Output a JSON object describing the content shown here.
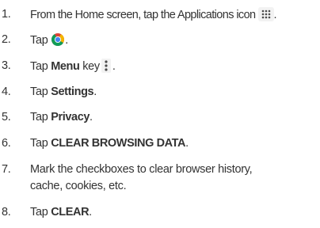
{
  "steps": [
    {
      "number": "1.",
      "text": "From the Home screen, tap the Applications icon",
      "suffix": ".",
      "icon": "applications-grid-icon"
    },
    {
      "number": "2.",
      "text": "Tap",
      "suffix": ".",
      "icon": "chrome-icon"
    },
    {
      "number": "3.",
      "pre": "Tap",
      "bold": "Menu",
      "text": "key",
      "suffix": ".",
      "icon": "menu-key-icon"
    },
    {
      "number": "4.",
      "pre": "Tap",
      "bold": "Settings",
      "suffix": "."
    },
    {
      "number": "5.",
      "pre": "Tap",
      "bold": "Privacy",
      "suffix": "."
    },
    {
      "number": "6.",
      "pre": "Tap",
      "bold": "CLEAR BROWSING DATA",
      "suffix": "."
    },
    {
      "number": "7.",
      "line1": "Mark the checkboxes to clear browser history,",
      "line2": "cache, cookies, etc."
    },
    {
      "number": "8.",
      "pre": "Tap",
      "bold": "CLEAR",
      "suffix": "."
    }
  ],
  "colors": {
    "text": "#333333",
    "icon_background": "#f2f2f2",
    "chrome_red": "#db4437",
    "chrome_yellow": "#f4b400",
    "chrome_green": "#0f9d58",
    "chrome_blue": "#4285f4"
  }
}
